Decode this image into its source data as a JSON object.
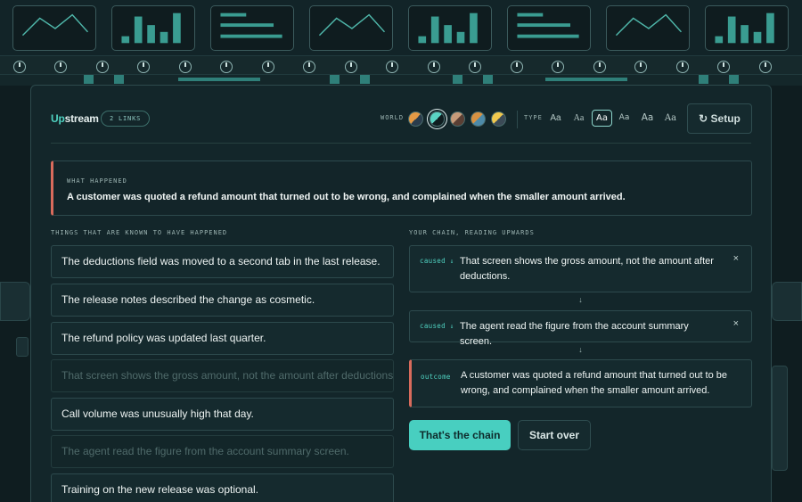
{
  "app": {
    "brand_prefix": "Up",
    "brand_suffix": "stream",
    "links_badge": "2 LINKS",
    "world_label": "WORLD",
    "type_label": "TYPE",
    "setup_label": "↻ Setup"
  },
  "world_swatches": [
    {
      "name": "orange-navy",
      "colors": [
        "#e49a45",
        "#2a3c4c"
      ],
      "active": false
    },
    {
      "name": "teal-dark",
      "colors": [
        "#5ad4c4",
        "#0f1d20"
      ],
      "active": true
    },
    {
      "name": "tan-brown",
      "colors": [
        "#c69b7a",
        "#5a3f34"
      ],
      "active": false
    },
    {
      "name": "orange-blue",
      "colors": [
        "#d89242",
        "#4d8aa8"
      ],
      "active": false
    },
    {
      "name": "gold-slate",
      "colors": [
        "#f0c84e",
        "#3b4a56"
      ],
      "active": false
    }
  ],
  "type_options": [
    {
      "label": "Aa",
      "active": false
    },
    {
      "label": "Aa",
      "active": false
    },
    {
      "label": "Aa",
      "active": true
    },
    {
      "label": "Aa",
      "active": false
    },
    {
      "label": "Aa",
      "active": false
    },
    {
      "label": "Aa",
      "active": false
    }
  ],
  "what_happened": {
    "label": "WHAT HAPPENED",
    "text": "A customer was quoted a refund amount that turned out to be wrong, and complained when the smaller amount arrived."
  },
  "facts_label": "THINGS THAT ARE KNOWN TO HAVE HAPPENED",
  "facts": [
    {
      "text": "The deductions field was moved to a second tab in the last release.",
      "used": false
    },
    {
      "text": "The release notes described the change as cosmetic.",
      "used": false
    },
    {
      "text": "The refund policy was updated last quarter.",
      "used": false
    },
    {
      "text": "That screen shows the gross amount, not the amount after deductions.",
      "used": true
    },
    {
      "text": "Call volume was unusually high that day.",
      "used": false
    },
    {
      "text": "The agent read the figure from the account summary screen.",
      "used": true
    },
    {
      "text": "Training on the new release was optional.",
      "used": false
    }
  ],
  "chain_label": "YOUR CHAIN, READING UPWARDS",
  "chain": [
    {
      "tag": "caused ↓",
      "text": "That screen shows the gross amount, not the amount after deductions.",
      "close": "×"
    },
    {
      "tag": "caused ↓",
      "text": "The agent read the figure from the account summary screen.",
      "close": "×"
    }
  ],
  "arrow_glyph": "↓",
  "outcome": {
    "tag": "outcome",
    "text": "A customer was quoted a refund amount that turned out to be wrong, and complained when the smaller amount arrived."
  },
  "buttons": {
    "confirm": "That's the chain",
    "reset": "Start over"
  },
  "colors": {
    "accent": "#48cfc0",
    "alert": "#d86b5c",
    "background": "#0f1d20"
  }
}
